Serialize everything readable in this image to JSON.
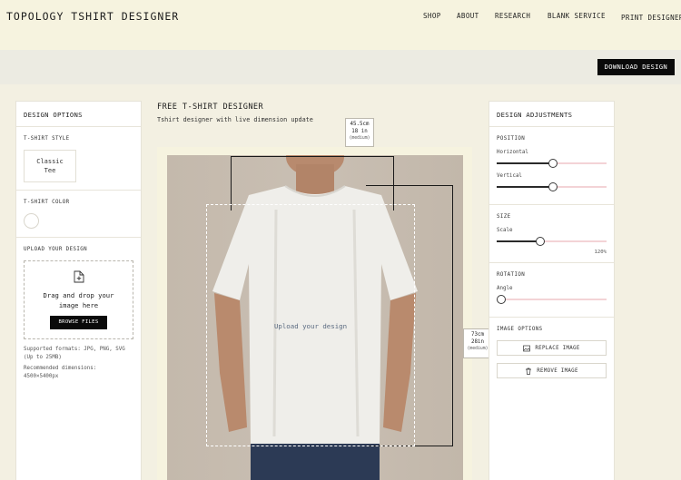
{
  "app": {
    "title": "TOPOLOGY TSHIRT DESIGNER"
  },
  "nav": {
    "items": [
      "SHOP",
      "ABOUT",
      "RESEARCH",
      "BLANK SERVICE",
      "PRINT DESIGNER"
    ]
  },
  "toolbar": {
    "download_label": "DOWNLOAD DESIGN"
  },
  "left_panel": {
    "title": "DESIGN OPTIONS",
    "style": {
      "title": "T-SHIRT STYLE",
      "card_label": "Classic Tee"
    },
    "color": {
      "title": "T-SHIRT COLOR",
      "selected": "#ffffff"
    },
    "upload": {
      "title": "UPLOAD YOUR DESIGN",
      "drop_text": "Drag and drop your image here",
      "browse_label": "BROWSE FILES",
      "formats": "Supported formats: JPG, PNG, SVG (Up to 25MB)",
      "recommended": "Recommended dimensions: 4500×5400px"
    }
  },
  "center": {
    "title": "FREE T-SHIRT DESIGNER",
    "subtitle": "Tshirt designer with live dimension update",
    "upload_hint": "Upload your design",
    "width_label": {
      "cm": "45.5cm",
      "in": "18 in",
      "size": "(medium)"
    },
    "height_label": {
      "cm": "73cm",
      "in": "28in",
      "size": "(medium)"
    }
  },
  "right_panel": {
    "title": "DESIGN ADJUSTMENTS",
    "position": {
      "title": "POSITION",
      "horizontal_label": "Horizontal",
      "horizontal_value": 0.51,
      "vertical_label": "Vertical",
      "vertical_value": 0.51
    },
    "size": {
      "title": "SIZE",
      "scale_label": "Scale",
      "scale_value": 0.39,
      "scale_text": "120%"
    },
    "rotation": {
      "title": "ROTATION",
      "angle_label": "Angle",
      "angle_value": 0.0
    },
    "image_options": {
      "title": "IMAGE OPTIONS",
      "replace_label": "REPLACE IMAGE",
      "remove_label": "REMOVE IMAGE"
    }
  },
  "colors": {
    "accent": "#0a0a0a",
    "slider_track": "#f3d3d6",
    "background": "#f3f0e2"
  }
}
